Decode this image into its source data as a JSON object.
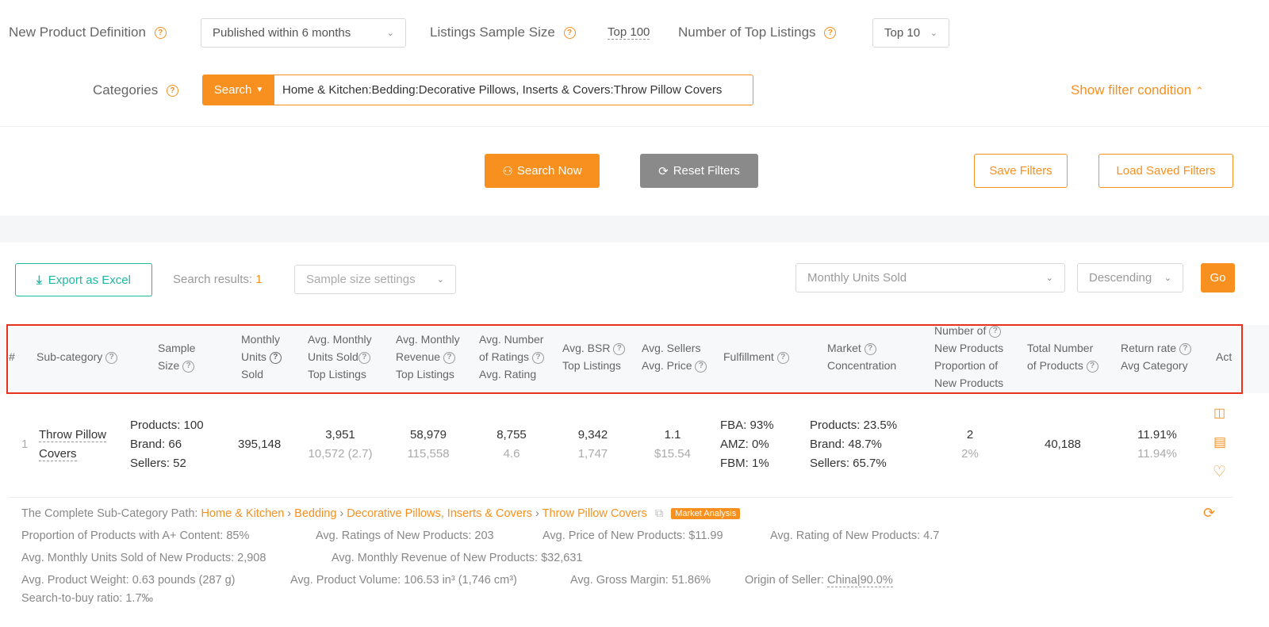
{
  "filters": {
    "new_product_label": "New Product Definition",
    "new_product_value": "Published within 6 months",
    "sample_size_label": "Listings Sample Size",
    "sample_size_value": "Top 100",
    "top_listings_label": "Number of Top Listings",
    "top_listings_value": "Top 10",
    "categories_label": "Categories",
    "search_dropdown": "Search",
    "category_value": "Home & Kitchen:Bedding:Decorative Pillows, Inserts & Covers:Throw Pillow Covers",
    "show_filter": "Show filter condition"
  },
  "actions": {
    "search_now": "Search Now",
    "reset": "Reset Filters",
    "save": "Save Filters",
    "load": "Load Saved Filters"
  },
  "toolbar": {
    "export": "Export as Excel",
    "results_label": "Search results:",
    "results_count": "1",
    "sample_settings": "Sample size settings",
    "sort_field": "Monthly Units Sold",
    "sort_order": "Descending",
    "go": "Go"
  },
  "headers": {
    "num": "#",
    "subcat": "Sub-category",
    "sample1": "Sample",
    "sample2": "Size",
    "mus1": "Monthly",
    "mus2": "Units",
    "mus3": "Sold",
    "amu1": "Avg. Monthly",
    "amu2": "Units Sold",
    "amu3": "Top Listings",
    "amr1": "Avg. Monthly",
    "amr2": "Revenue",
    "amr3": "Top Listings",
    "anr1": "Avg. Number",
    "anr2": "of Ratings",
    "anr3": "Avg. Rating",
    "bsr1": "Avg. BSR",
    "bsr2": "Top Listings",
    "as1": "Avg. Sellers",
    "as2": "Avg. Price",
    "ful": "Fulfillment",
    "mc1": "Market",
    "mc2": "Concentration",
    "np1": "Number of",
    "np2": "New Products",
    "np3": "Proportion of",
    "np4": "New Products",
    "tn1": "Total Number",
    "tn2": "of Products",
    "rr1": "Return rate",
    "rr2": "Avg Category",
    "act": "Act"
  },
  "row": {
    "index": "1",
    "subcat1": "Throw Pillow",
    "subcat2": "Covers",
    "products": "Products: 100",
    "brand": "Brand: 66",
    "sellers": "Sellers: 52",
    "monthly_units": "395,148",
    "avg_units": "3,951",
    "avg_units_sub": "10,572 (2.7)",
    "avg_rev": "58,979",
    "avg_rev_sub": "115,558",
    "ratings": "8,755",
    "rating_avg": "4.6",
    "bsr": "9,342",
    "bsr_sub": "1,747",
    "sellers_avg": "1.1",
    "price_avg": "$15.54",
    "fba": "FBA: 93%",
    "amz": "AMZ: 0%",
    "fbm": "FBM: 1%",
    "mc_products": "Products: 23.5%",
    "mc_brand": "Brand: 48.7%",
    "mc_sellers": "Sellers: 65.7%",
    "new_products": "2",
    "new_prop": "2%",
    "total": "40,188",
    "return_rate": "11.91%",
    "return_avg": "11.94%"
  },
  "details": {
    "path_label": "The Complete Sub-Category Path:",
    "path": [
      "Home & Kitchen",
      "Bedding",
      "Decorative Pillows, Inserts & Covers",
      "Throw Pillow Covers"
    ],
    "sep": "›",
    "market_badge": "Market Analysis",
    "aplus": "Proportion of Products with A+ Content: 85%",
    "ratings_new": "Avg. Ratings of New Products: 203",
    "price_new": "Avg. Price of New Products: $11.99",
    "rating_new": "Avg. Rating of New Products: 4.7",
    "units_new": "Avg. Monthly Units Sold of New Products: 2,908",
    "revenue_new": "Avg. Monthly Revenue of New Products: $32,631",
    "weight": "Avg. Product Weight: 0.63 pounds (287 g)",
    "volume": "Avg. Product Volume: 106.53 in³ (1,746 cm³)",
    "margin": "Avg. Gross Margin: 51.86%",
    "origin_label": "Origin of Seller:",
    "origin_value": "China|90.0%",
    "search_buy": "Search-to-buy ratio: 1.7‰"
  },
  "colors": {
    "accent": "#f7901e",
    "teal": "#1fb8a0",
    "highlight": "#e8321e",
    "gray_btn": "#8a8a8a"
  }
}
